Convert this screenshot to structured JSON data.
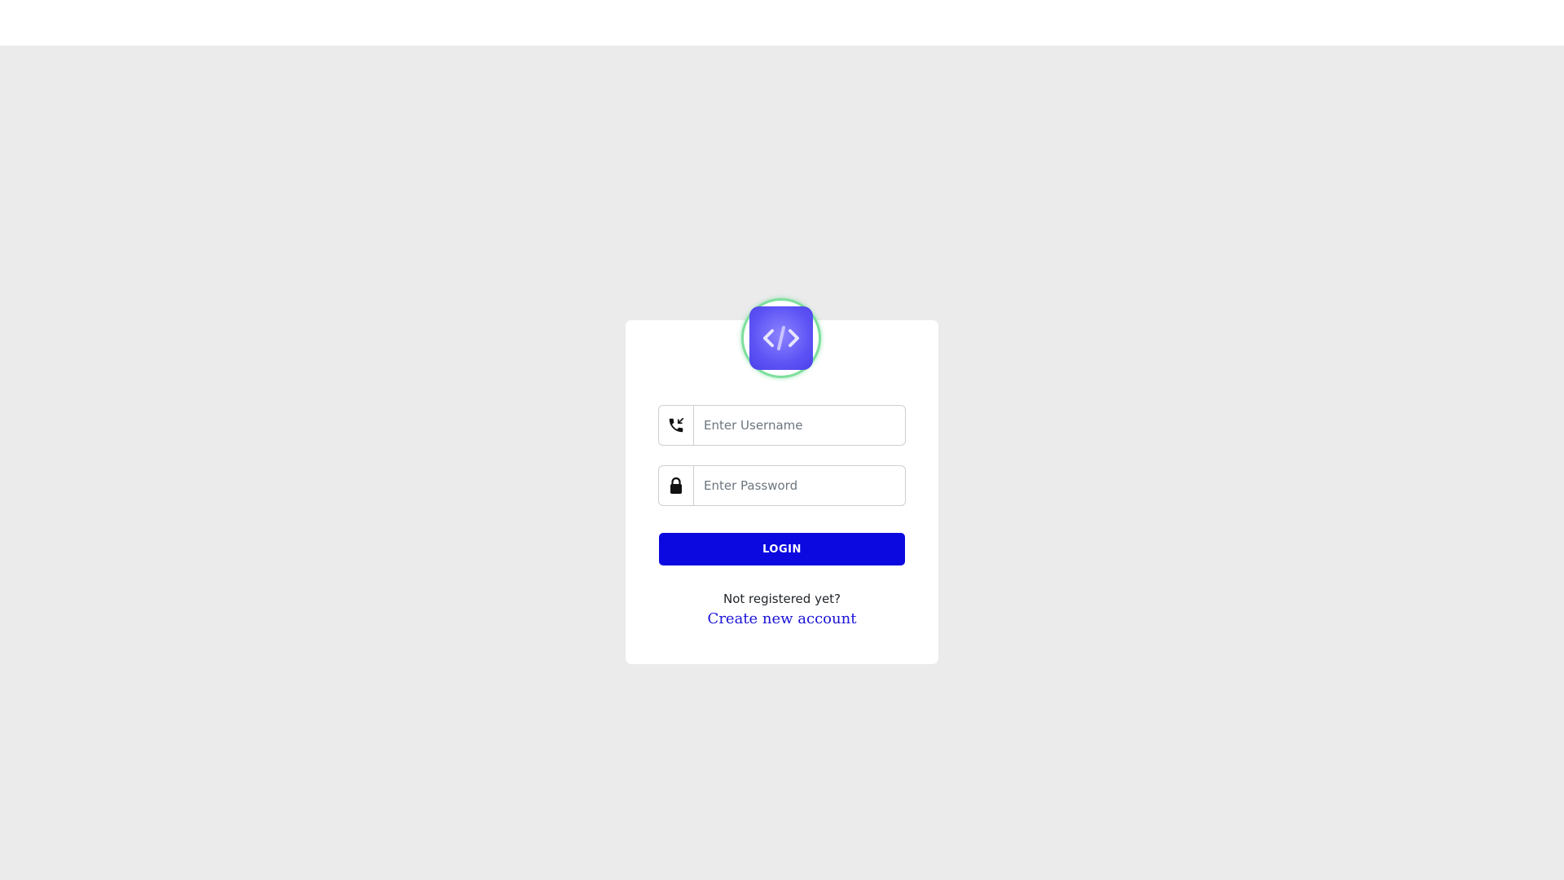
{
  "login_form": {
    "logo": {
      "icon": "code-icon"
    },
    "username": {
      "icon": "phone-incoming-icon",
      "placeholder": "Enter Username",
      "value": ""
    },
    "password": {
      "icon": "lock-icon",
      "placeholder": "Enter Password",
      "value": ""
    },
    "submit_label": "LOGIN",
    "signup_prompt": "Not registered yet?",
    "signup_link": "Create new account"
  },
  "colors": {
    "page_background": "#ebebeb",
    "primary_button": "#0b08e0",
    "link": "#1a12d6",
    "logo_ring": "#7ddf9c",
    "logo_tile": "#5e54f5"
  }
}
